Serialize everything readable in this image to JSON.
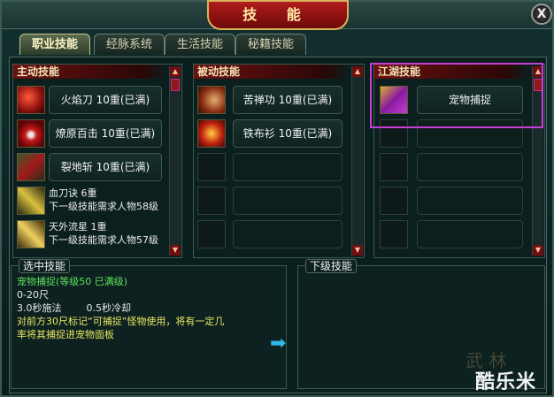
{
  "window": {
    "title": "技 能",
    "close_label": "X"
  },
  "tabs": [
    {
      "label": "职业技能",
      "active": true
    },
    {
      "label": "经脉系统",
      "active": false
    },
    {
      "label": "生活技能",
      "active": false
    },
    {
      "label": "秘籍技能",
      "active": false
    }
  ],
  "active_skills": {
    "header": "主动技能",
    "items": [
      {
        "name": "火焰刀 10重(已满)",
        "icon": "fire-blade-icon"
      },
      {
        "name": "燎原百击 10重(已满)",
        "icon": "prairie-fire-icon"
      },
      {
        "name": "裂地斩 10重(已满)",
        "icon": "earth-split-icon"
      },
      {
        "line1": "血刀诀 6重",
        "line2": "下一级技能需求人物58级",
        "icon": "blood-blade-icon"
      },
      {
        "line1": "天外流星 1重",
        "line2": "下一级技能需求人物57级",
        "icon": "meteor-icon"
      }
    ]
  },
  "passive_skills": {
    "header": "被动技能",
    "items": [
      {
        "name": "苦禅功 10重(已满)",
        "icon": "zen-skill-icon"
      },
      {
        "name": "铁布衫 10重(已满)",
        "icon": "iron-shirt-icon"
      }
    ]
  },
  "jianghu_skills": {
    "header": "江湖技能",
    "items": [
      {
        "name": "宠物捕捉",
        "icon": "pet-capture-icon"
      }
    ]
  },
  "selected_skill": {
    "label": "选中技能",
    "title": "宠物捕捉(等级50 已满级)",
    "range": "0-20尺",
    "cast": "3.0秒施法        0.5秒冷却",
    "desc1": "对前方30尺标记“可捕捉”怪物使用，将有一定几",
    "desc2": "率将其捕捉进宠物面板"
  },
  "next_level": {
    "label": "下级技能"
  },
  "watermark": {
    "text": "酷乐米"
  },
  "colors": {
    "accent_red": "#8a1b1b",
    "highlight": "#c63fd6",
    "skill_green": "#5fe05f",
    "arrow": "#2fb8e8"
  }
}
